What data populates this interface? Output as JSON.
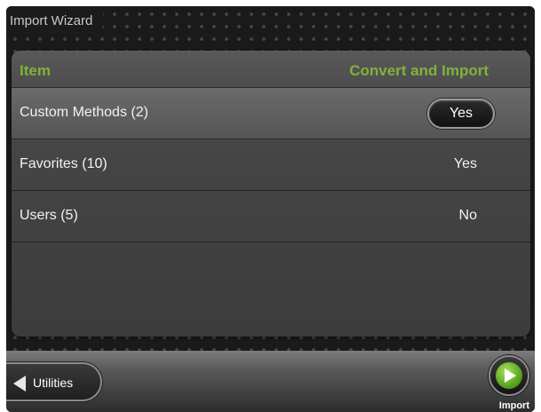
{
  "window": {
    "title": "Import Wizard"
  },
  "table": {
    "headers": {
      "item": "Item",
      "action": "Convert and Import"
    },
    "rows": [
      {
        "label": "Custom Methods (2)",
        "value": "Yes",
        "selected": true
      },
      {
        "label": "Favorites (10)",
        "value": "Yes",
        "selected": false
      },
      {
        "label": "Users (5)",
        "value": "No",
        "selected": false
      }
    ]
  },
  "footer": {
    "back_label": "Utilities",
    "next_label": "Import"
  },
  "colors": {
    "header_text": "#7fb33a",
    "accent_green": "#5aa51f"
  },
  "icons": {
    "back": "arrow-left-icon",
    "next": "play-circle-icon"
  }
}
